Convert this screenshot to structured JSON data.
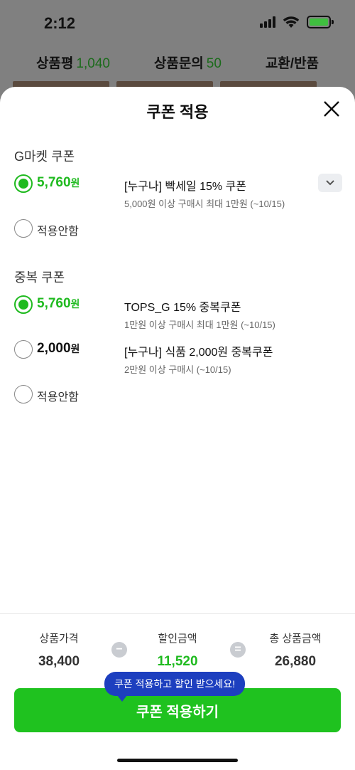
{
  "status_bar": {
    "time": "2:12"
  },
  "background_tabs": [
    {
      "label": "상품평",
      "count": "1,040"
    },
    {
      "label": "상품문의",
      "count": "50"
    },
    {
      "label": "교환/반품",
      "count": ""
    }
  ],
  "sheet": {
    "title": "쿠폰 적용"
  },
  "gmarket_section": {
    "title": "G마켓 쿠폰",
    "options": [
      {
        "amount": "5,760",
        "unit": "원",
        "name": "[누구나] 빡세일 15% 쿠폰",
        "desc": "5,000원 이상 구매시 최대 1만원 (~10/15)",
        "selected": true
      },
      {
        "no_apply_label": "적용안함",
        "selected": false
      }
    ]
  },
  "overlap_section": {
    "title": "중복 쿠폰",
    "options": [
      {
        "amount": "5,760",
        "unit": "원",
        "name": "TOPS_G 15% 중복쿠폰",
        "desc": "1만원 이상 구매시 최대 1만원 (~10/15)",
        "selected": true
      },
      {
        "amount": "2,000",
        "unit": "원",
        "name": "[누구나] 식품 2,000원 중복쿠폰",
        "desc": "2만원 이상 구매시 (~10/15)",
        "selected": false
      },
      {
        "no_apply_label": "적용안함",
        "selected": false
      }
    ]
  },
  "summary": {
    "price_label": "상품가격",
    "price_value": "38,400",
    "minus_symbol": "−",
    "discount_label": "할인금액",
    "discount_value": "11,520",
    "equals_symbol": "=",
    "total_label": "총 상품금액",
    "total_value": "26,880"
  },
  "tooltip": "쿠폰 적용하고 할인 받으세요!",
  "apply_button": "쿠폰 적용하기",
  "colors": {
    "accent": "#1fba1f",
    "tooltip": "#1d3fbf"
  }
}
